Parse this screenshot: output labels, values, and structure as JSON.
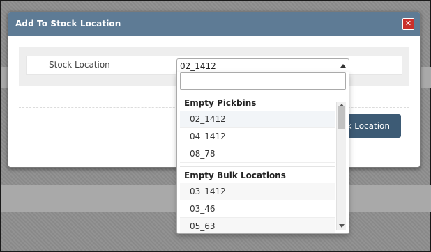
{
  "dialog": {
    "title": "Add To Stock Location",
    "close_glyph": "✕"
  },
  "form": {
    "stock_location_label": "Stock Location",
    "selected_value": "02_1412"
  },
  "action_button": {
    "label": "ck Location"
  },
  "dropdown": {
    "search_value": "",
    "groups": [
      {
        "label": "Empty Pickbins",
        "options": [
          "02_1412",
          "04_1412",
          "08_78"
        ]
      },
      {
        "label": "Empty Bulk Locations",
        "options": [
          "03_1412",
          "03_46",
          "05_63"
        ]
      }
    ]
  }
}
